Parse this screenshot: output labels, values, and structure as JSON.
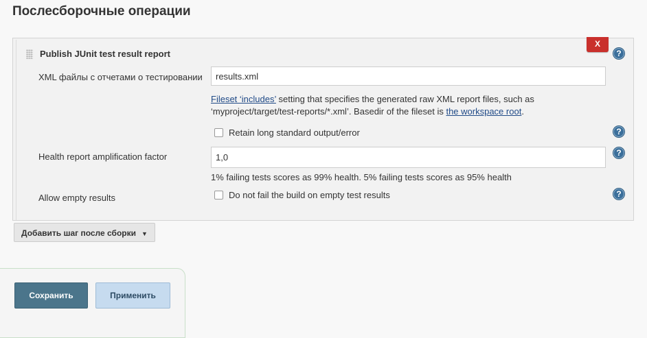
{
  "section": {
    "title": "Послесборочные операции"
  },
  "step": {
    "title": "Publish JUnit test result report",
    "delete_label": "X",
    "help_symbol": "?",
    "xml_files": {
      "label": "XML файлы с отчетами о тестировании",
      "value": "results.xml"
    },
    "fileset_help": {
      "link1": "Fileset ‘includes’",
      "text1": " setting that specifies the generated raw XML report files, such as",
      "text2": "‘myproject/target/test-reports/*.xml’. Basedir of the fileset is ",
      "link2": "the workspace root",
      "text3": "."
    },
    "retain_output": {
      "label": "Retain long standard output/error",
      "checked": false
    },
    "health_factor": {
      "label": "Health report amplification factor",
      "value": "1,0",
      "hint": "1% failing tests scores as 99% health. 5% failing tests scores as 95% health"
    },
    "allow_empty": {
      "label": "Allow empty results",
      "checkbox_label": "Do not fail the build on empty test results",
      "checked": false
    }
  },
  "add_step_button": {
    "label": "Добавить шаг после сборки"
  },
  "buttons": {
    "save": "Сохранить",
    "apply": "Применить"
  },
  "colors": {
    "delete": "#c9302c",
    "help": "#3b6f9b",
    "save": "#4b758b",
    "apply": "#c6dbef",
    "link": "#204a87"
  }
}
